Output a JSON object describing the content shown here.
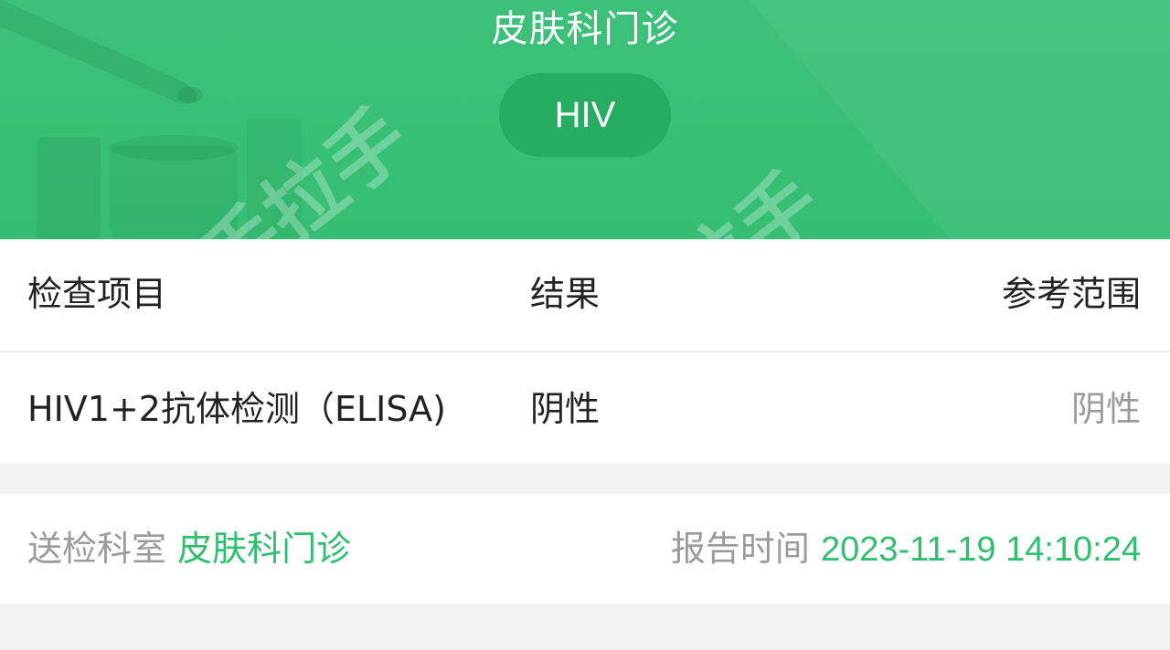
{
  "header": {
    "department_title": "皮肤科门诊",
    "test_name": "HIV",
    "background_color": "#3ABF76",
    "pill_color": "#27AD62"
  },
  "table": {
    "columns": [
      "检查项目",
      "结果",
      "参考范围"
    ],
    "rows": [
      {
        "item": "HIV1+2抗体检测（ELISA)",
        "result": "阴性",
        "reference": "阴性"
      }
    ]
  },
  "footer": {
    "department_label": "送检科室",
    "department_value": "皮肤科门诊",
    "report_time_label": "报告时间",
    "report_time_value": "2023-11-19 14:10:24"
  },
  "colors": {
    "accent": "#2FBF6E",
    "muted_text": "#9B9B9B",
    "primary_text": "#222222",
    "page_background": "#F2F2F2"
  },
  "watermark": "手拉手"
}
